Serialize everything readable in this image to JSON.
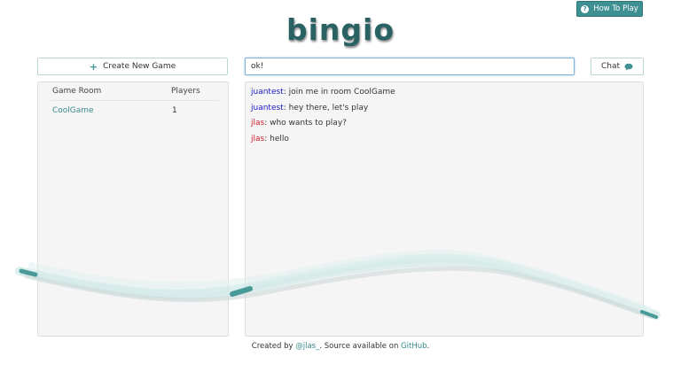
{
  "header": {
    "logo": "bingio",
    "how_to_play_label": "How To Play",
    "how_to_play_icon": "question-circle-icon"
  },
  "lobby": {
    "create_label": "Create New Game",
    "create_icon": "plus-icon",
    "columns": {
      "room": "Game Room",
      "players": "Players"
    },
    "rooms": [
      {
        "name": "CoolGame",
        "players": "1"
      }
    ]
  },
  "chat": {
    "input_value": "ok!",
    "send_label": "Chat",
    "send_icon": "speech-bubble-icon",
    "messages": [
      {
        "user": "juantest",
        "text": ": join me in room CoolGame",
        "color": "#1b1bc4"
      },
      {
        "user": "juantest",
        "text": ": hey there, let's play",
        "color": "#1b1bc4"
      },
      {
        "user": "jlas",
        "text": ": who wants to play?",
        "color": "#cc2233"
      },
      {
        "user": "jlas",
        "text": ": hello",
        "color": "#cc2233"
      }
    ]
  },
  "footer": {
    "created_by": "Created by ",
    "author_link": "@jlas_",
    "middle": ". Source available on ",
    "github_link": "GitHub",
    "end": "."
  },
  "colors": {
    "accent": "#3f9093",
    "link": "#3a8a8c",
    "logo": "#2a6264"
  }
}
